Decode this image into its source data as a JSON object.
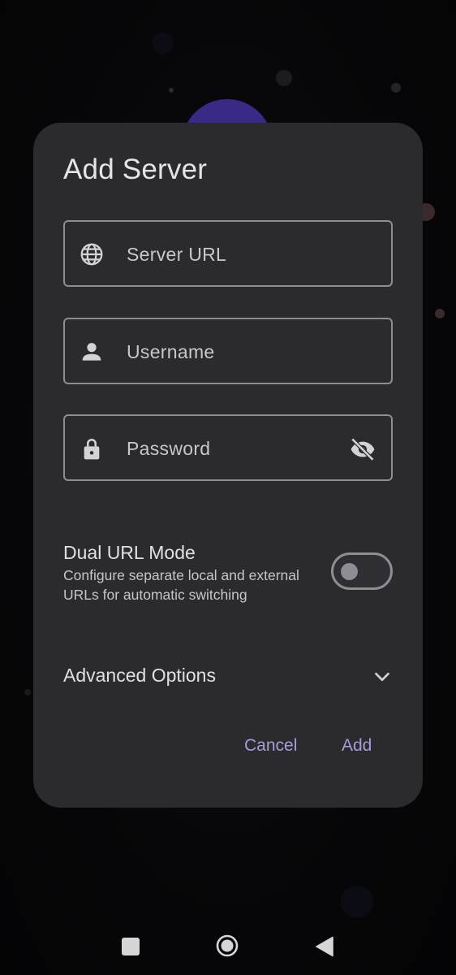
{
  "dialog": {
    "title": "Add Server",
    "fields": [
      {
        "icon": "globe-icon",
        "placeholder": "Server URL"
      },
      {
        "icon": "person-icon",
        "placeholder": "Username"
      },
      {
        "icon": "lock-icon",
        "placeholder": "Password",
        "trailing_icon": "visibility-off-icon"
      }
    ],
    "dual_url": {
      "title": "Dual URL Mode",
      "description": "Configure separate local and external URLs for automatic switching",
      "enabled": false
    },
    "advanced": {
      "label": "Advanced Options",
      "icon": "chevron-down-icon"
    },
    "actions": {
      "cancel_label": "Cancel",
      "add_label": "Add"
    }
  },
  "navbar": {
    "icons": [
      "recents-square-icon",
      "home-circle-icon",
      "back-triangle-icon"
    ]
  },
  "colors": {
    "dialog_bg": "#2b2b2e",
    "accent": "#a99bdc",
    "outline": "#8f8d93",
    "orb": "#3a2a86"
  }
}
